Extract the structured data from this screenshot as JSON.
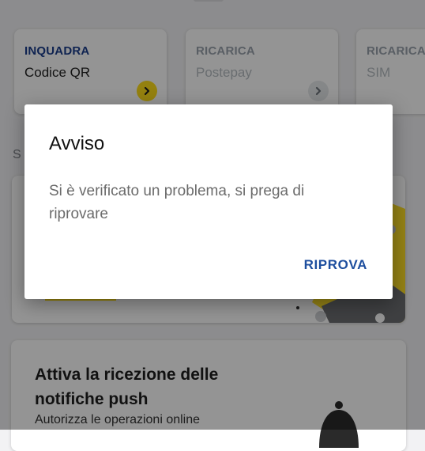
{
  "quick_actions": [
    {
      "kicker": "INQUADRA",
      "title": "Codice QR"
    },
    {
      "kicker": "RICARICA",
      "title": "Postepay"
    },
    {
      "kicker": "RICARICA",
      "title": "SIM"
    }
  ],
  "section": {
    "title": "S"
  },
  "push_card": {
    "title": "Attiva la ricezione delle notifiche push",
    "body": "Autorizza le operazioni online"
  },
  "dialog": {
    "title": "Avviso",
    "message": "Si è verificato un problema, si prega di riprovare",
    "button_label": "RIPROVA"
  },
  "colors": {
    "brand_blue": "#1d4e9e",
    "accent_yellow": "#ffdf1a",
    "scrim": "rgba(0,0,0,0.42)"
  }
}
